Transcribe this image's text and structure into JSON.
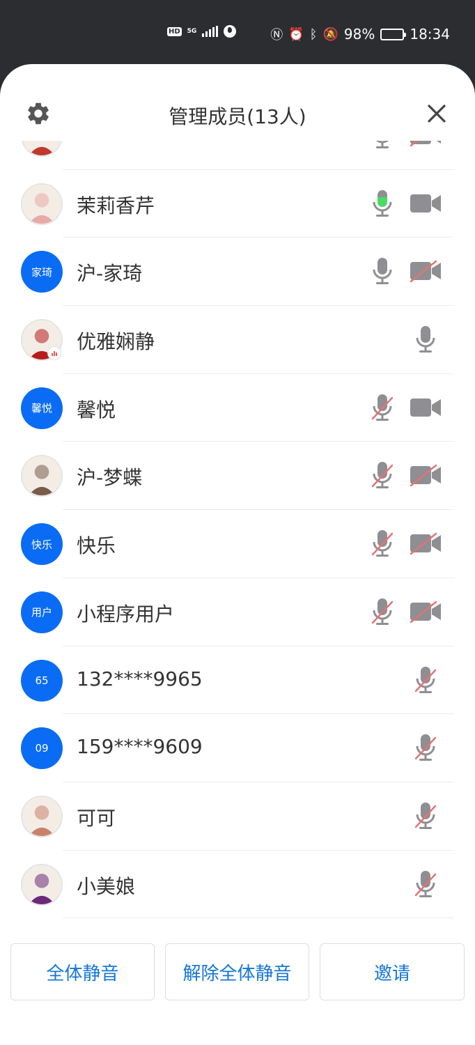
{
  "status_bar": {
    "battery": "98%",
    "time": "18:34",
    "hd": "HD",
    "network": "5G"
  },
  "header": {
    "title": "管理成员(13人)"
  },
  "members": [
    {
      "name": "",
      "avatar_type": "photo",
      "avatar_color": "#c0392b",
      "mic": "off",
      "cam": "off",
      "partial": true
    },
    {
      "name": "茉莉香芹",
      "avatar_type": "photo",
      "avatar_color": "#e9a9a4",
      "mic": "active",
      "cam": "on"
    },
    {
      "name": "沪-家琦",
      "avatar_type": "text",
      "avatar_text": "家琦",
      "mic": "on",
      "cam": "off"
    },
    {
      "name": "优雅娴静",
      "avatar_type": "photo",
      "avatar_color": "#b71c1c",
      "mic": "on",
      "cam": "none",
      "speaking_badge": true
    },
    {
      "name": "馨悦",
      "avatar_type": "text",
      "avatar_text": "馨悦",
      "mic": "muted",
      "cam": "on"
    },
    {
      "name": "沪-梦蝶",
      "avatar_type": "photo",
      "avatar_color": "#7a5a48",
      "mic": "muted",
      "cam": "off"
    },
    {
      "name": "快乐",
      "avatar_type": "text",
      "avatar_text": "快乐",
      "mic": "muted",
      "cam": "off"
    },
    {
      "name": "小程序用户",
      "avatar_type": "text",
      "avatar_text": "用户",
      "mic": "muted",
      "cam": "off"
    },
    {
      "name": "132****9965",
      "avatar_type": "text",
      "avatar_text": "65",
      "mic": "muted",
      "cam": "none"
    },
    {
      "name": "159****9609",
      "avatar_type": "text",
      "avatar_text": "09",
      "mic": "muted",
      "cam": "none"
    },
    {
      "name": "可可",
      "avatar_type": "photo",
      "avatar_color": "#c9826a",
      "mic": "muted",
      "cam": "none"
    },
    {
      "name": "小美娘",
      "avatar_type": "photo",
      "avatar_color": "#6a2a7a",
      "mic": "muted",
      "cam": "none"
    }
  ],
  "footer": {
    "mute_all": "全体静音",
    "unmute_all": "解除全体静音",
    "invite": "邀请"
  },
  "colors": {
    "accent_blue": "#0a6cf5",
    "button_text": "#1476d8",
    "mic_active": "#4cd964",
    "muted_slash": "#e57373",
    "icon_gray": "#8e8e93"
  }
}
